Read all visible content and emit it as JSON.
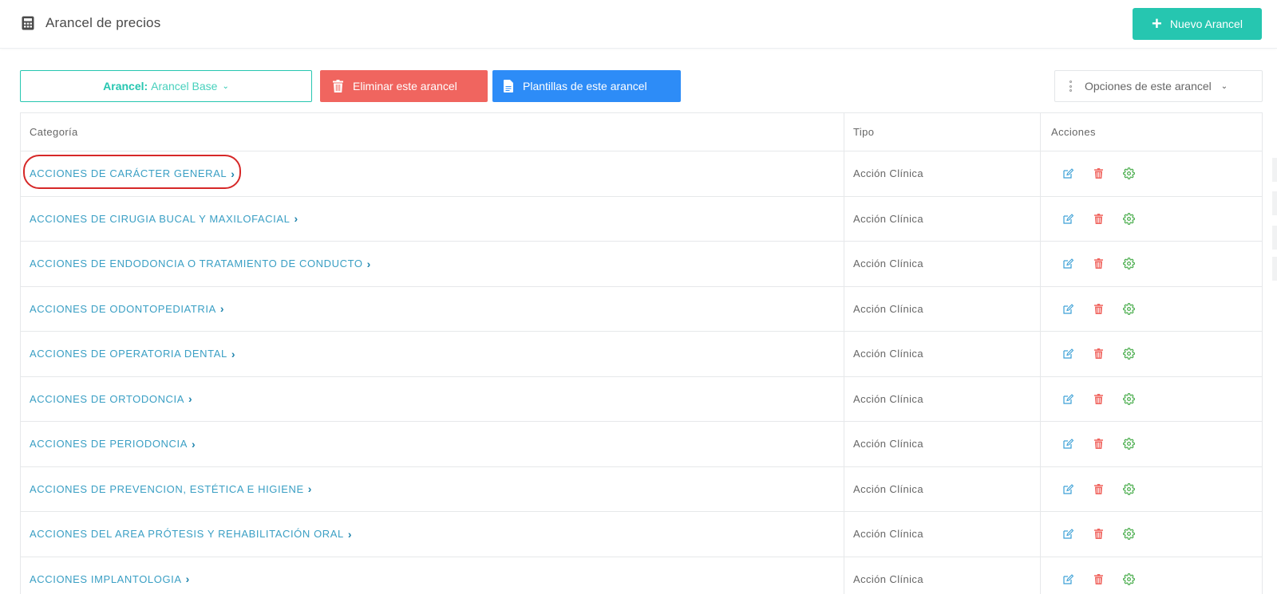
{
  "header": {
    "title": "Arancel de precios",
    "title_icon": "calculator-icon",
    "new_button": {
      "label": "Nuevo Arancel",
      "icon": "plus-icon"
    }
  },
  "toolbar": {
    "arancel_selector": {
      "label": "Arancel:",
      "value": "Arancel Base",
      "icon": "chevron-down-icon"
    },
    "delete_button": {
      "label": "Eliminar este arancel",
      "icon": "trash-icon"
    },
    "templates_button": {
      "label": "Plantillas de este arancel",
      "icon": "document-icon"
    },
    "options_button": {
      "label": "Opciones de este arancel",
      "icon": "vertical-dots-icon"
    }
  },
  "table": {
    "columns": [
      "Categoría",
      "Tipo",
      "Acciones"
    ],
    "rows": [
      {
        "category": "ACCIONES DE CARÁCTER GENERAL",
        "type": "Acción Clínica"
      },
      {
        "category": "ACCIONES DE CIRUGIA BUCAL Y MAXILOFACIAL",
        "type": "Acción Clínica"
      },
      {
        "category": "ACCIONES DE ENDODONCIA O TRATAMIENTO DE CONDUCTO",
        "type": "Acción Clínica"
      },
      {
        "category": "ACCIONES DE ODONTOPEDIATRIA",
        "type": "Acción Clínica"
      },
      {
        "category": "ACCIONES DE OPERATORIA DENTAL",
        "type": "Acción Clínica"
      },
      {
        "category": "ACCIONES DE ORTODONCIA",
        "type": "Acción Clínica"
      },
      {
        "category": "ACCIONES DE PERIODONCIA",
        "type": "Acción Clínica"
      },
      {
        "category": "ACCIONES DE PREVENCION, ESTÉTICA E HIGIENE",
        "type": "Acción Clínica"
      },
      {
        "category": "ACCIONES DEL AREA PRÓTESIS Y REHABILITACIÓN ORAL",
        "type": "Acción Clínica"
      },
      {
        "category": "ACCIONES IMPLANTOLOGIA",
        "type": "Acción Clínica"
      }
    ],
    "row_actions": [
      "edit-icon",
      "trash-icon",
      "gear-icon"
    ]
  },
  "colors": {
    "teal": "#26c6b0",
    "red": "#f0655f",
    "blue": "#2d8cf7",
    "link": "#3a9fc4",
    "highlight": "#d62828"
  }
}
